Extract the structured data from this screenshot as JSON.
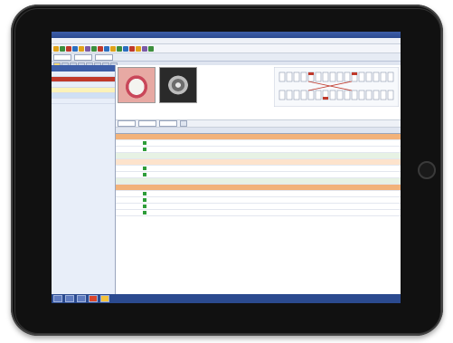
{
  "app": {
    "title_text": ""
  },
  "menu": {
    "items": [
      "",
      "",
      "",
      "",
      "",
      "",
      "",
      ""
    ]
  },
  "patient": {
    "name_value": "",
    "id_value": "",
    "date_value": ""
  },
  "tabs": [
    "",
    "",
    "",
    "",
    "",
    "",
    "",
    ""
  ],
  "sidebar": {
    "header": "",
    "items": [
      {
        "label": "",
        "style": "normal"
      },
      {
        "label": "",
        "style": "red"
      },
      {
        "label": "",
        "style": "normal"
      },
      {
        "label": "",
        "style": "yellow"
      },
      {
        "label": "",
        "style": "blue"
      },
      {
        "label": "",
        "style": "normal"
      }
    ]
  },
  "filters": {
    "from_label": "",
    "to_label": "",
    "mode_label": "",
    "button_label": ""
  },
  "table": {
    "columns": [
      "",
      "",
      "",
      "",
      "",
      "",
      "",
      ""
    ],
    "rows": [
      {
        "style": "section-orange",
        "cells": [
          "",
          "",
          "",
          "",
          ""
        ]
      },
      {
        "style": "normal",
        "cells": [
          "",
          "",
          "",
          "",
          ""
        ]
      },
      {
        "style": "normal",
        "cells": [
          "",
          "",
          "",
          "",
          ""
        ]
      },
      {
        "style": "highlight",
        "cells": [
          "",
          "",
          "",
          "",
          ""
        ]
      },
      {
        "style": "section-light",
        "cells": [
          "",
          "",
          "",
          "",
          ""
        ]
      },
      {
        "style": "normal",
        "cells": [
          "",
          "",
          "",
          "",
          ""
        ]
      },
      {
        "style": "normal",
        "cells": [
          "",
          "",
          "",
          "",
          ""
        ]
      },
      {
        "style": "highlight",
        "cells": [
          "",
          "",
          "",
          "",
          ""
        ]
      },
      {
        "style": "section-orange",
        "cells": [
          "",
          "",
          "",
          "",
          ""
        ]
      },
      {
        "style": "normal",
        "cells": [
          "",
          "",
          "",
          "",
          ""
        ]
      },
      {
        "style": "normal",
        "cells": [
          "",
          "",
          "",
          "",
          ""
        ]
      },
      {
        "style": "normal",
        "cells": [
          "",
          "",
          "",
          "",
          ""
        ]
      },
      {
        "style": "normal",
        "cells": [
          "",
          "",
          "",
          "",
          ""
        ]
      }
    ]
  },
  "colors": {
    "bezel": "#111111",
    "titlebar": "#2b4a8f",
    "active_tab": "#f7d97b",
    "section_orange": "#f2b27a",
    "status_green": "#2e9d3a"
  },
  "icons": {
    "home_button": "home-button-icon",
    "toolbar": [
      "app-icon",
      "toolbar-icon"
    ]
  }
}
